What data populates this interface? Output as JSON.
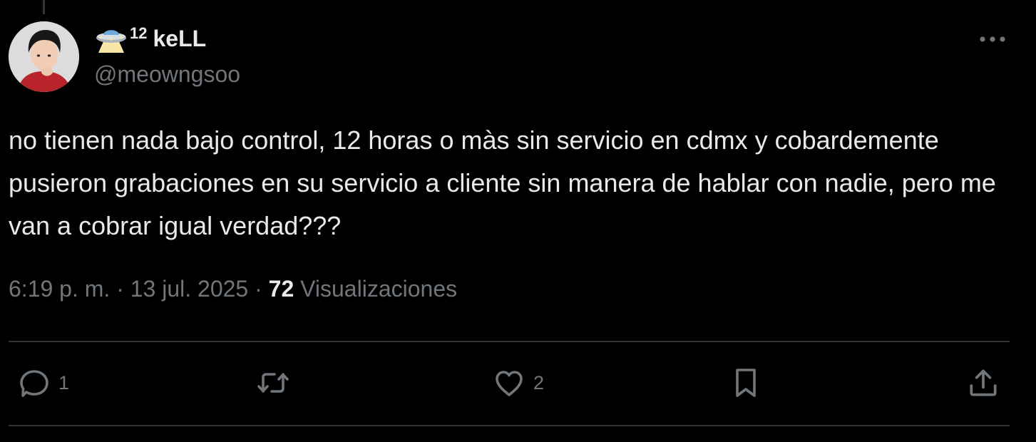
{
  "author": {
    "name_emoji_icon": "ufo-icon",
    "name_superscript": "12",
    "display_name": "keLL",
    "handle": "@meowngsoo"
  },
  "tweet": {
    "text": "no tienen nada bajo control, 12 horas o màs sin servicio en cdmx y cobardemente pusieron grabaciones en su servicio a cliente sin manera de hablar con nadie, pero me van a cobrar igual verdad???"
  },
  "meta": {
    "time": "6:19 p. m.",
    "separator": " · ",
    "date": "13 jul. 2025",
    "views_count": "72",
    "views_label": "Visualizaciones"
  },
  "actions": {
    "reply_count": "1",
    "retweet_count": "",
    "like_count": "2"
  },
  "colors": {
    "background": "#000000",
    "text_primary": "#e7e9ea",
    "text_secondary": "#71767b",
    "divider": "#2f3336"
  }
}
